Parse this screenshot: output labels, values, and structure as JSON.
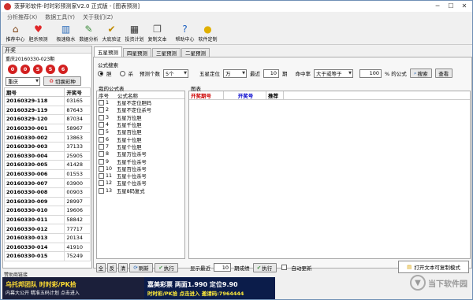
{
  "title": "菠萝彩软件-时时彩预测家V2.0 正式版 - [图表预测]",
  "menu": [
    "分析推荐(X)",
    "数据工具(Y)",
    "关于我们(Z)"
  ],
  "toolbar": [
    {
      "label": "推荐中心",
      "icon": "home-icon"
    },
    {
      "label": "胆杀预测",
      "icon": "heart-icon"
    },
    {
      "label": "极速稳水",
      "icon": "chart-icon"
    },
    {
      "label": "数据分析",
      "icon": "pencil-chart-icon"
    },
    {
      "label": "大底验证",
      "icon": "check-icon"
    },
    {
      "label": "投资计划",
      "icon": "grid-icon"
    },
    {
      "label": "复制文本",
      "icon": "copy-icon"
    },
    {
      "label": "帮助中心",
      "icon": "help-icon"
    },
    {
      "label": "软件定制",
      "icon": "bulb-icon"
    }
  ],
  "left": {
    "header": "开奖",
    "issue_label": "重庆20160330-023期",
    "balls": [
      "0",
      "0",
      "5",
      "5",
      "6"
    ],
    "region": "重庆",
    "switch_button": "切换彩种",
    "columns": [
      "期号",
      "开奖号"
    ],
    "rows": [
      [
        "20160329-118",
        "03165"
      ],
      [
        "20160329-119",
        "87643"
      ],
      [
        "20160329-120",
        "87034"
      ],
      [
        "20160330-001",
        "58967"
      ],
      [
        "20160330-002",
        "13863"
      ],
      [
        "20160330-003",
        "37133"
      ],
      [
        "20160330-004",
        "25905"
      ],
      [
        "20160330-005",
        "41428"
      ],
      [
        "20160330-006",
        "01553"
      ],
      [
        "20160330-007",
        "03900"
      ],
      [
        "20160330-008",
        "00903"
      ],
      [
        "20160330-009",
        "28997"
      ],
      [
        "20160330-010",
        "19606"
      ],
      [
        "20160330-011",
        "58842"
      ],
      [
        "20160330-012",
        "77717"
      ],
      [
        "20160330-013",
        "20134"
      ],
      [
        "20160330-014",
        "41910"
      ],
      [
        "20160330-015",
        "75249"
      ]
    ]
  },
  "tabs": [
    "五星预测",
    "四星预测",
    "三星预测",
    "二星预测"
  ],
  "search": {
    "group_label": "公式搜索",
    "radio_dan": "胆",
    "radio_sha": "杀",
    "pred_count_label": "预测个数",
    "pred_count": "5个",
    "position_label": "五星定位",
    "position": "万",
    "recent_label": "最近",
    "recent": "10",
    "period_label": "期",
    "hit_label": "命中率",
    "hit_op": "大于或等于",
    "hit_value": "100",
    "hit_suffix": "% 的公式",
    "search_btn": "搜索",
    "view_btn": "查看"
  },
  "formulas": {
    "caption": "我的公式表",
    "columns": [
      "序号",
      "公式名称"
    ],
    "items": [
      [
        "1",
        "五星不定位胆码"
      ],
      [
        "2",
        "五星不定位杀号"
      ],
      [
        "3",
        "五星万位胆"
      ],
      [
        "4",
        "五星千位胆"
      ],
      [
        "5",
        "五星百位胆"
      ],
      [
        "6",
        "五星十位胆"
      ],
      [
        "7",
        "五星个位胆"
      ],
      [
        "8",
        "五星万位杀号"
      ],
      [
        "9",
        "五星千位杀号"
      ],
      [
        "10",
        "五星百位杀号"
      ],
      [
        "11",
        "五星十位杀号"
      ],
      [
        "12",
        "五星个位杀号"
      ],
      [
        "13",
        "五星8码复式"
      ]
    ]
  },
  "chart": {
    "caption": "图表",
    "columns": [
      "开奖期号",
      "开奖号",
      "推荐"
    ]
  },
  "bottom": {
    "all": "全",
    "inv": "反",
    "clear": "清",
    "refresh": "刷新",
    "execute": "执行",
    "show_label": "显示最近",
    "show_value": "10",
    "show_suffix": "期成绩",
    "exec2": "执行",
    "auto_update": "自动更新",
    "open_text": "打开文本可复制模式"
  },
  "status": "赞助商链接",
  "banner": {
    "left_title": "乌托邦团队 时时彩/PK拾",
    "left_sub": "内幕大公开 精准五码计划 点击进入",
    "right_title": "嘉美彩票 两面1.990 定位9.90",
    "right_sub": "时时彩/PK拾 点击进入 邀请码:7964444"
  },
  "watermark": "当下软件园"
}
